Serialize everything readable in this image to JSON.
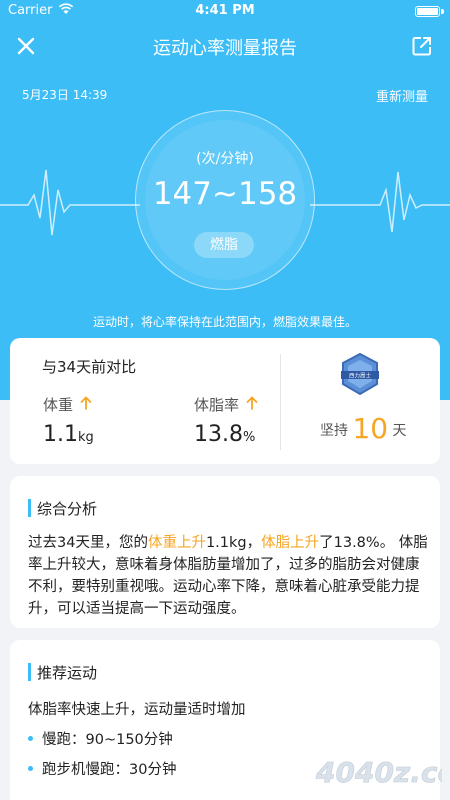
{
  "statusbar": {
    "carrier": "Carrier",
    "time": "4:41 PM"
  },
  "header": {
    "title": "运动心率测量报告",
    "date": "5月23日 14:39",
    "remeasure": "重新测量"
  },
  "heart": {
    "unit": "(次/分钟)",
    "range": "147~158",
    "zone": "燃脂",
    "hint": "运动时，将心率保持在此范围内，燃脂效果最佳。"
  },
  "compare": {
    "title": "与34天前对比",
    "weight": {
      "label": "体重",
      "value": "1.1",
      "unit": "kg"
    },
    "bodyfat": {
      "label": "体脂率",
      "value": "13.8",
      "unit": "%"
    },
    "medal_text": "西力周士",
    "persist_prefix": "坚持",
    "persist_days": "10",
    "persist_suffix": "天"
  },
  "analysis": {
    "title": "综合分析",
    "p1": "过去34天里，您的",
    "h1": "体重上升",
    "p2": "1.1kg，",
    "h2": "体脂上升",
    "p3": "了13.8%。 体脂率上升较大，意味着身体脂肪量增加了，过多的脂肪会对健康不利，要特别重视哦。运动心率下降，意味着心脏承受能力提升，可以适当提高一下运动强度。"
  },
  "recommend": {
    "title": "推荐运动",
    "intro": "体脂率快速上升，运动量适时增加",
    "items": [
      "慢跑：90~150分钟",
      "跑步机慢跑：30分钟"
    ]
  },
  "watermark": "4040z.com",
  "colors": {
    "brand": "#3cbdf6",
    "highlight": "#f5a623"
  }
}
